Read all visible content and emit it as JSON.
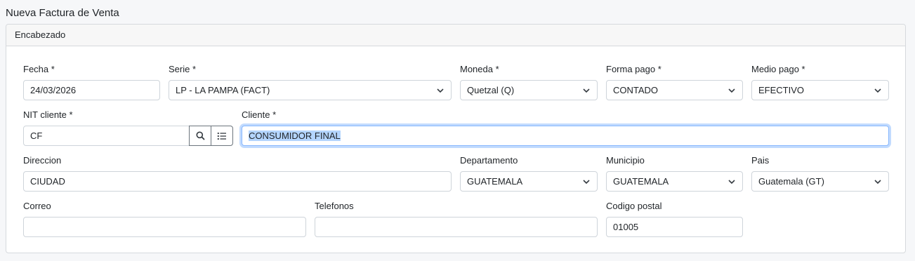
{
  "page": {
    "title": "Nueva Factura de Venta"
  },
  "section": {
    "title": "Encabezado"
  },
  "fields": {
    "fecha": {
      "label": "Fecha *",
      "value": "24/03/2026"
    },
    "serie": {
      "label": "Serie *",
      "value": "LP - LA PAMPA (FACT)"
    },
    "moneda": {
      "label": "Moneda *",
      "value": "Quetzal (Q)"
    },
    "forma_pago": {
      "label": "Forma pago *",
      "value": "CONTADO"
    },
    "medio_pago": {
      "label": "Medio pago *",
      "value": "EFECTIVO"
    },
    "nit": {
      "label": "NIT cliente *",
      "value": "CF"
    },
    "cliente": {
      "label": "Cliente *",
      "value": "CONSUMIDOR FINAL"
    },
    "direccion": {
      "label": "Direccion",
      "value": "CIUDAD"
    },
    "departamento": {
      "label": "Departamento",
      "value": "GUATEMALA"
    },
    "municipio": {
      "label": "Municipio",
      "value": "GUATEMALA"
    },
    "pais": {
      "label": "Pais",
      "value": "Guatemala (GT)"
    },
    "correo": {
      "label": "Correo",
      "value": ""
    },
    "telefonos": {
      "label": "Telefonos",
      "value": ""
    },
    "codigo_postal": {
      "label": "Codigo postal",
      "value": "01005"
    }
  },
  "icons": {
    "search": "search-icon",
    "list": "list-icon",
    "select_arrow": "chevron-down-icon"
  },
  "colors": {
    "focus_border": "#86b7fe",
    "selection": "#b4d5fe",
    "button_border": "#6c757d"
  }
}
